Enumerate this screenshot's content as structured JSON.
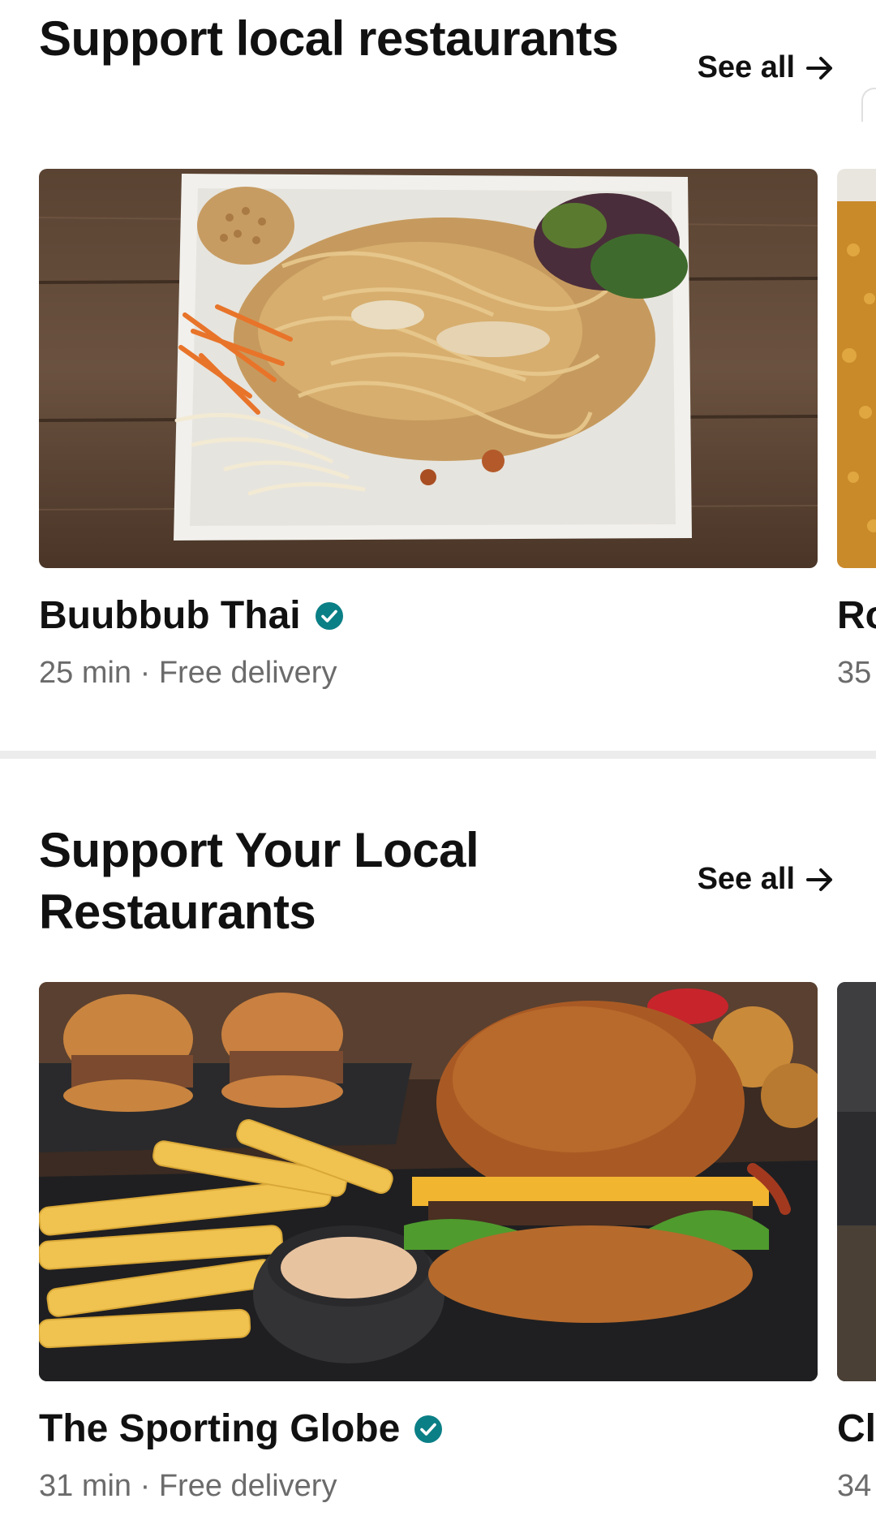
{
  "sections": [
    {
      "title": "Support local restaurants",
      "see_all_label": "See all",
      "featured": {
        "name": "Buubbub Thai",
        "meta": "25 min · Free delivery",
        "verified": true,
        "image": "pad-thai-photo"
      },
      "peek": {
        "name": "Ro",
        "meta": "35"
      }
    },
    {
      "title": "Support Your Local Restaurants",
      "see_all_label": "See all",
      "featured": {
        "name": "The Sporting Globe",
        "meta": "31 min · Free delivery",
        "verified": true,
        "image": "burger-and-fries-photo"
      },
      "peek": {
        "name": "Cl",
        "meta": "34"
      }
    }
  ],
  "colors": {
    "verified_badge": "#0b7f86",
    "meta_text": "#6b6b6b",
    "divider": "#ececec"
  }
}
